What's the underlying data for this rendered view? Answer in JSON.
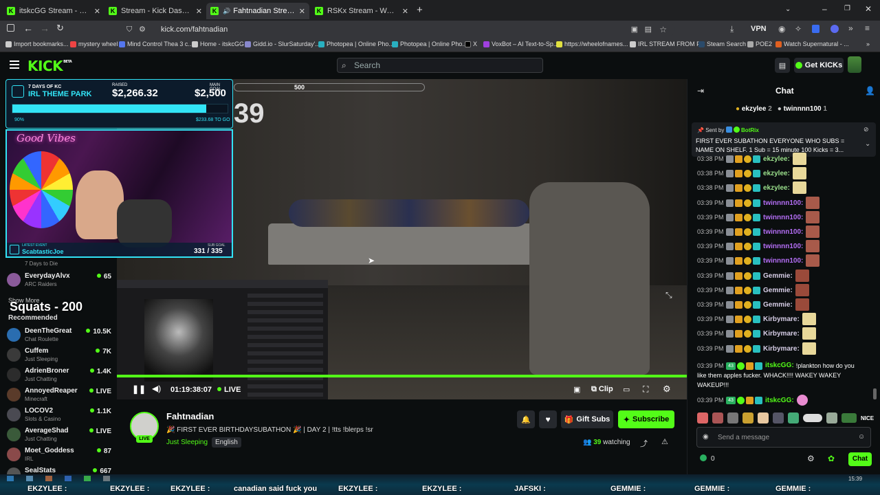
{
  "browser": {
    "tabs": [
      {
        "label": "itskcGG Stream - Watch Live o",
        "active": false
      },
      {
        "label": "Stream - Kick Dashboard",
        "active": false
      },
      {
        "label": "Fahtnadian Stream - Watch",
        "active": true
      },
      {
        "label": "RSKx Stream - Watch Live o",
        "active": false
      }
    ],
    "url": "kick.com/fahtnadian",
    "vpn_label": "VPN",
    "bookmarks": [
      "Import bookmarks...",
      "mystery wheel",
      "Mind Control Thea 3 c...",
      "Home - itskcGG",
      "Gidd.io - SlurSaturday'...",
      "Photopea | Online Pho...",
      "Photopea | Online Pho...",
      "X",
      "VoxBot – AI Text-to-Sp...",
      "https://wheelofnames...",
      "IRL STREAM FROM PC",
      "Steam Search",
      "POE2",
      "Watch Supernatural - ..."
    ]
  },
  "header": {
    "logo": "KICK",
    "logo_sup": "BETA",
    "search_placeholder": "Search",
    "get_kicks": "Get KICKs"
  },
  "overlay": {
    "event_title_top": "7 DAYS OF KC",
    "event_title": "IRL THEME PARK",
    "raised_label": "RAISED",
    "raised_value": "$2,266.32",
    "goal_label": "MAIN GOAL",
    "goal_value": "$2,500",
    "progress_pct_label": "90%",
    "progress_fraction": 0.9,
    "to_go": "$233.68 TO GO",
    "neon_sign": "Good Vibes",
    "latest_event_label": "LATEST EVENT",
    "latest_event_user": "ScabtasticJoe",
    "sub_goal_label": "SUB GOAL",
    "sub_goal_value": "331 / 335"
  },
  "video": {
    "hud_number": "500",
    "hud_big": "39",
    "overlay_text": "Squats - 200",
    "timestamp": "01:19:38:07",
    "live_label": "LIVE",
    "clip_label": "Clip"
  },
  "sidebar": {
    "partial_top": {
      "category": "7 Days to Die"
    },
    "followed": [
      {
        "name": "EverydayAlvx",
        "category": "ARC Raiders",
        "viewers": "65",
        "color": "#8a5a9a"
      }
    ],
    "show_more": "Show More",
    "recommended_title": "Recommended",
    "recommended": [
      {
        "name": "DeenTheGreat",
        "category": "Chat Roulette",
        "viewers": "10.5K",
        "color": "#2a6db0"
      },
      {
        "name": "Cuffem",
        "category": "Just Sleeping",
        "viewers": "7K",
        "color": "#3a3a3a"
      },
      {
        "name": "AdrienBroner",
        "category": "Just Chatting",
        "viewers": "1.4K",
        "color": "#2c2c2c"
      },
      {
        "name": "AnnoyedReaper",
        "category": "Minecraft",
        "viewers": "LIVE",
        "color": "#5a3b2a"
      },
      {
        "name": "LOCOV2",
        "category": "Slots & Casino",
        "viewers": "1.1K",
        "color": "#4a4a52"
      },
      {
        "name": "AverageShad",
        "category": "Just Chatting",
        "viewers": "LIVE",
        "color": "#3a5a3a"
      },
      {
        "name": "Moet_Goddess",
        "category": "IRL",
        "viewers": "87",
        "color": "#8a4a4a"
      },
      {
        "name": "SealStats",
        "category": "",
        "viewers": "667",
        "color": "#555"
      }
    ]
  },
  "stream_info": {
    "channel": "Fahtnadian",
    "title": "🎉 FIRST EVER BIRTHDAYSUBATHON 🎉 | DAY 2 | !tts !blerps !sr",
    "category": "Just Sleeping",
    "language": "English",
    "live_badge": "LIVE",
    "gift_subs": "Gift Subs",
    "subscribe": "Subscribe",
    "viewers": "39",
    "watching_label": "watching"
  },
  "chat": {
    "title": "Chat",
    "top_gifters": [
      {
        "name": "ekzylee",
        "count": "2"
      },
      {
        "name": "twinnnn100",
        "count": "1"
      }
    ],
    "pinned": {
      "sent_by_label": "Sent by",
      "sender": "BotRix",
      "text_line1": "FIRST EVER SUBATHON EVERYONE WHO SUBS =",
      "text_line2": "NAME ON SHELF. 1 Sub = 15 minute 100 Kicks = 3..."
    },
    "messages": [
      {
        "time": "03:38 PM",
        "user": "ekzylee:",
        "color": "#9be08c"
      },
      {
        "time": "03:38 PM",
        "user": "ekzylee:",
        "color": "#9be08c"
      },
      {
        "time": "03:38 PM",
        "user": "ekzylee:",
        "color": "#9be08c"
      },
      {
        "time": "03:39 PM",
        "user": "twinnnn100:",
        "color": "#b46ef5"
      },
      {
        "time": "03:39 PM",
        "user": "twinnnn100:",
        "color": "#b46ef5"
      },
      {
        "time": "03:39 PM",
        "user": "twinnnn100:",
        "color": "#b46ef5"
      },
      {
        "time": "03:39 PM",
        "user": "twinnnn100:",
        "color": "#b46ef5"
      },
      {
        "time": "03:39 PM",
        "user": "twinnnn100:",
        "color": "#b46ef5"
      },
      {
        "time": "03:39 PM",
        "user": "Gemmie:",
        "color": "#d6cde6"
      },
      {
        "time": "03:39 PM",
        "user": "Gemmie:",
        "color": "#d6cde6"
      },
      {
        "time": "03:39 PM",
        "user": "Gemmie:",
        "color": "#d6cde6"
      },
      {
        "time": "03:39 PM",
        "user": "Kirbymare:",
        "color": "#d6cde6"
      },
      {
        "time": "03:39 PM",
        "user": "Kirbymare:",
        "color": "#d6cde6"
      },
      {
        "time": "03:39 PM",
        "user": "Kirbymare:",
        "color": "#d6cde6"
      }
    ],
    "long_msg": {
      "time": "03:39 PM",
      "badge_num": "43",
      "user": "itskcGG:",
      "line1": "!plankton how do you",
      "line2": "like them apples fucker. WHACK!!!! WAKEY WAKEY",
      "line3": "WAKEUP!!!"
    },
    "last_msg": {
      "time": "03:39 PM",
      "badge_num": "43",
      "user": "itskcGG:"
    },
    "emote_bar_last": "NICE",
    "input_placeholder": "Send a message",
    "kicks_count": "0",
    "send_label": "Chat"
  },
  "ticker": {
    "items": [
      "EKZYLEE :",
      "EKZYLEE :",
      "EKZYLEE :",
      "canadian said fuck you",
      "EKZYLEE :",
      "EKZYLEE :",
      "JAFSKI :",
      "GEMMIE :",
      "GEMMIE :",
      "GEMMIE :"
    ],
    "clock_time": "15:39"
  },
  "colors": {
    "kick_green": "#53fc18",
    "cyan_accent": "#32e4f6",
    "dark_bg": "#0b0e0f"
  }
}
